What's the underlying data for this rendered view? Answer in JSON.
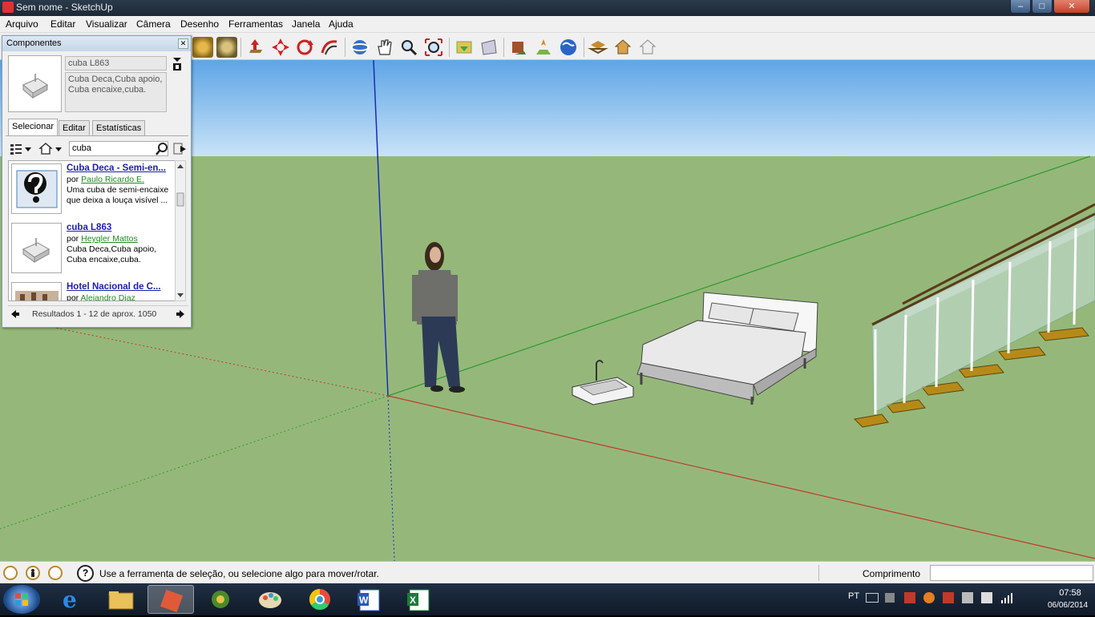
{
  "window": {
    "title": "Sem nome - SketchUp"
  },
  "menu": [
    "Arquivo",
    "Editar",
    "Visualizar",
    "Câmera",
    "Desenho",
    "Ferramentas",
    "Janela",
    "Ajuda"
  ],
  "panel": {
    "title": "Componentes",
    "component_name": "cuba L863",
    "component_desc": "Cuba Deca,Cuba apoio, Cuba encaixe,cuba.",
    "tabs": [
      "Selecionar",
      "Editar",
      "Estatísticas"
    ],
    "search_value": "cuba",
    "results": [
      {
        "title": "Cuba Deca - Semi-en...",
        "by": "por",
        "author": "Paulo Ricardo E.",
        "desc": "Uma cuba de semi-encaixe que deixa a louça visível ..."
      },
      {
        "title": "cuba L863",
        "by": "por",
        "author": "Heyqler Mattos",
        "desc": "Cuba Deca,Cuba apoio, Cuba encaixe,cuba."
      },
      {
        "title": "Hotel Nacional de C...",
        "by": "por",
        "author": "Alejandro Diaz",
        "desc": ""
      }
    ],
    "results_footer": "Resultados 1 - 12 de aprox. 1050"
  },
  "status": {
    "message": "Use a ferramenta de seleção, ou selecione algo para mover/rotar.",
    "measure_label": "Comprimento",
    "measure_value": ""
  },
  "taskbar": {
    "lang": "PT",
    "time": "07:58",
    "date": "06/06/2014"
  },
  "colors": {
    "sky_top": "#5ea5e6",
    "ground": "#95b87a",
    "axis_red": "#c0392b",
    "axis_green": "#2e9a2e",
    "axis_blue": "#1a2ab8"
  },
  "icons": [
    "select-icon",
    "eraser-icon",
    "paint-icon",
    "pushpull-icon",
    "move-icon",
    "rotate-icon",
    "followme-icon",
    "orbit-icon",
    "pan-icon",
    "zoom-icon",
    "zoom-extents-icon",
    "warehouse-get-icon",
    "share-model-icon",
    "component-share-icon",
    "geolocation-icon",
    "earth-icon",
    "extension-icon",
    "layer-icon",
    "house-icon"
  ]
}
